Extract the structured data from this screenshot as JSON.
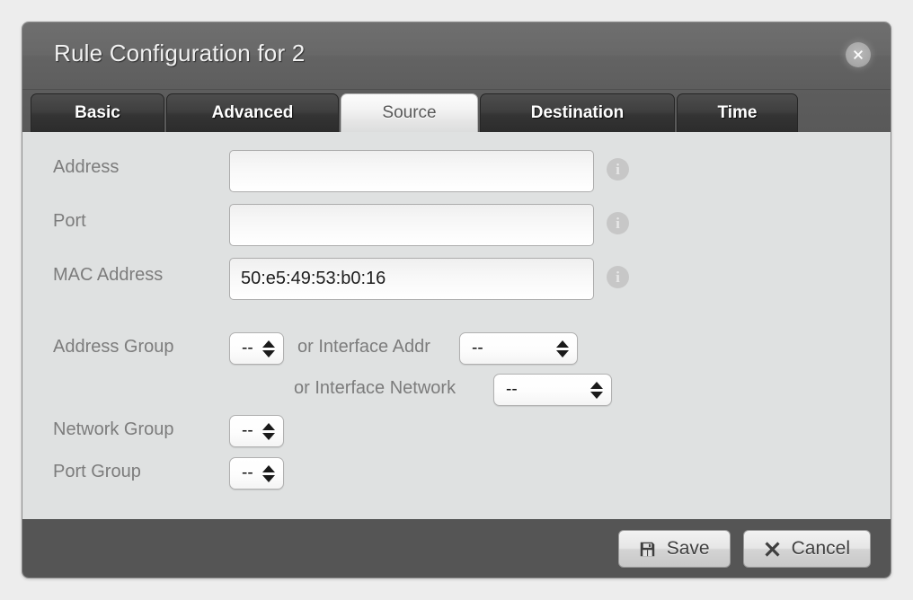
{
  "dialog": {
    "title": "Rule Configuration for 2",
    "close_icon": "close-circle-icon"
  },
  "tabs": [
    {
      "label": "Basic",
      "active": false
    },
    {
      "label": "Advanced",
      "active": false
    },
    {
      "label": "Source",
      "active": true
    },
    {
      "label": "Destination",
      "active": false
    },
    {
      "label": "Time",
      "active": false
    }
  ],
  "form": {
    "address": {
      "label": "Address",
      "value": "",
      "placeholder": "",
      "info_icon": "info-icon"
    },
    "port": {
      "label": "Port",
      "value": "",
      "placeholder": "",
      "info_icon": "info-icon"
    },
    "mac_address": {
      "label": "MAC Address",
      "value": "50:e5:49:53:b0:16",
      "placeholder": "",
      "info_icon": "info-icon"
    },
    "address_group": {
      "label": "Address Group",
      "selected": "--"
    },
    "interface_addr": {
      "label": "or Interface Addr",
      "selected": "--"
    },
    "interface_network": {
      "label": "or Interface Network",
      "selected": "--"
    },
    "network_group": {
      "label": "Network Group",
      "selected": "--"
    },
    "port_group": {
      "label": "Port Group",
      "selected": "--"
    }
  },
  "footer": {
    "save_label": "Save",
    "save_icon": "floppy-disk-icon",
    "cancel_label": "Cancel",
    "cancel_icon": "x-mark-icon"
  },
  "colors": {
    "header_bg": "#686868",
    "footer_bg": "#555555",
    "body_bg": "#dfe1e1",
    "page_bg": "#ededed",
    "label_text": "#7c7c7c",
    "active_tab_text": "#585858"
  }
}
